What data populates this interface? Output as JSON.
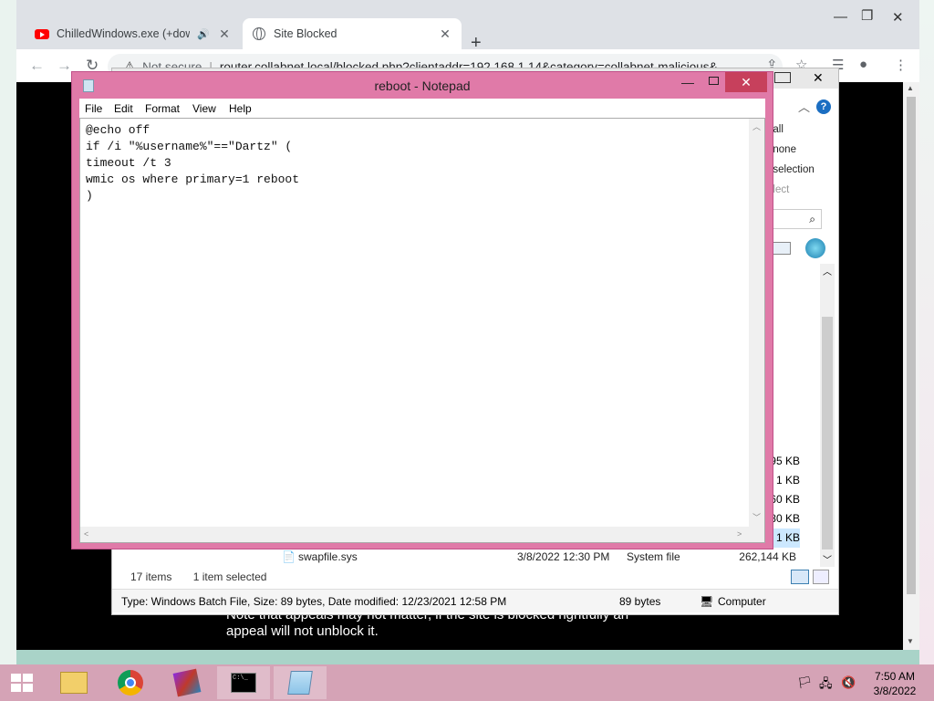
{
  "chrome": {
    "tabs": [
      {
        "title": "ChilledWindows.exe (+down",
        "icon": "youtube-icon"
      },
      {
        "title": "Site Blocked",
        "icon": "globe-icon"
      }
    ],
    "omnibox": {
      "security": "Not secure",
      "url": "router.collabnet.local/blocked.php?clientaddr=192.168.1.14&category=collabnet-malicious&"
    },
    "page_text": "Note that appeals may not matter, if the site is blocked rightfully an appeal will not unblock it."
  },
  "explorer": {
    "ribbon": [
      "t all",
      "t none",
      "t selection",
      "elect"
    ],
    "sizes": [
      "95 KB",
      "1 KB",
      "60 KB",
      "80 KB",
      "1 KB"
    ],
    "file_row": {
      "name": "swapfile.sys",
      "date": "3/8/2022 12:30 PM",
      "type": "System file",
      "size": "262,144 KB"
    },
    "item_count": "17 items",
    "selection": "1 item selected",
    "status": {
      "details": "Type: Windows Batch File, Size: 89 bytes, Date modified: 12/23/2021 12:58 PM",
      "size": "89 bytes",
      "location": "Computer"
    }
  },
  "notepad": {
    "title": "reboot - Notepad",
    "menu": [
      "File",
      "Edit",
      "Format",
      "View",
      "Help"
    ],
    "content": "@echo off\nif /i \"%username%\"==\"Dartz\" (\ntimeout /t 3\nwmic os where primary=1 reboot\n)"
  },
  "taskbar": {
    "time": "7:50 AM",
    "date": "3/8/2022"
  },
  "colors": {
    "notepad_frame": "#e07aa8",
    "taskbar": "#d5a3b6",
    "close_button": "#c7405c"
  }
}
